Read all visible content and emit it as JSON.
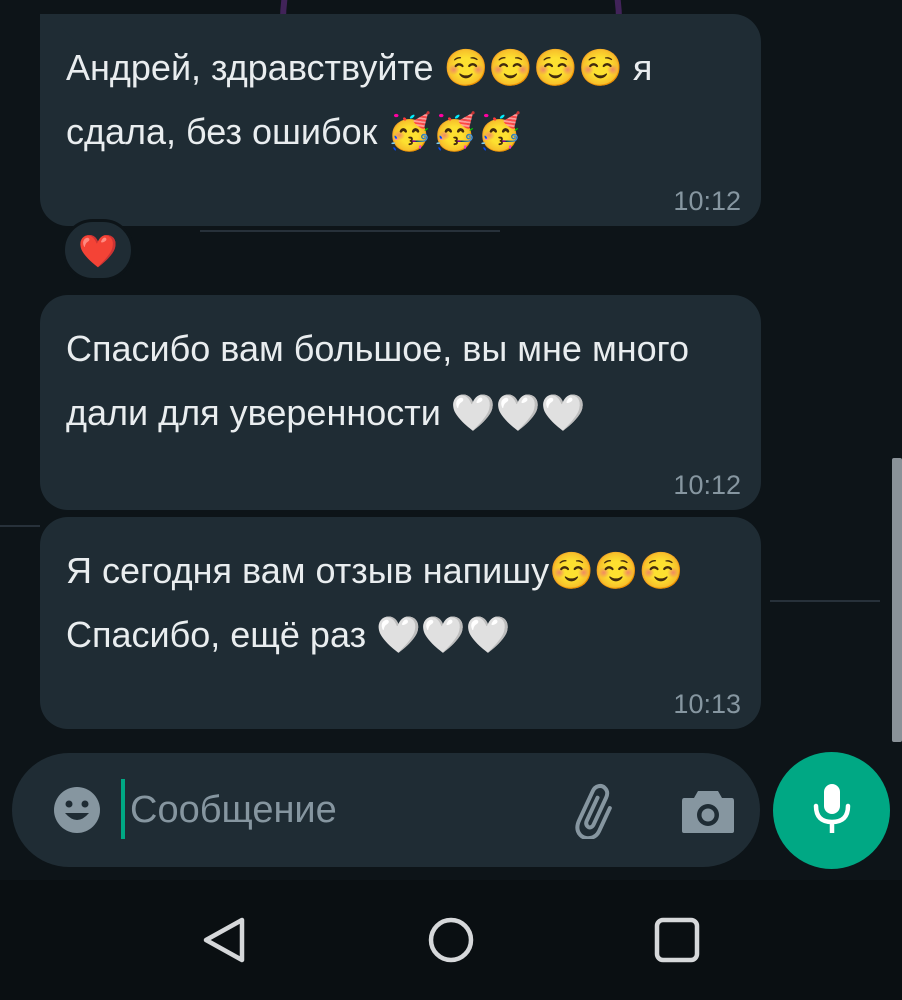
{
  "messages": [
    {
      "text": "Андрей, здравствуйте ☺️☺️☺️☺️ я сдала, без ошибок 🥳🥳🥳",
      "time": "10:12",
      "reaction": "❤️"
    },
    {
      "text": "Спасибо вам большое, вы мне много дали для уверенности 🤍🤍🤍",
      "time": "10:12"
    },
    {
      "text": "Я сегодня вам отзыв напишу☺️☺️☺️Спасибо, ещё раз 🤍🤍🤍",
      "time": "10:13"
    }
  ],
  "composer": {
    "placeholder": "Сообщение",
    "value": ""
  },
  "icons": {
    "emoji": "emoji-smile-icon",
    "attach": "paperclip-icon",
    "camera": "camera-icon",
    "mic": "microphone-icon",
    "nav_back": "triangle-back-icon",
    "nav_home": "circle-home-icon",
    "nav_recent": "square-recents-icon"
  },
  "colors": {
    "background": "#0d1418",
    "bubble": "#1f2c34",
    "text": "#e9edef",
    "time": "#8696a0",
    "accent": "#00a884"
  }
}
